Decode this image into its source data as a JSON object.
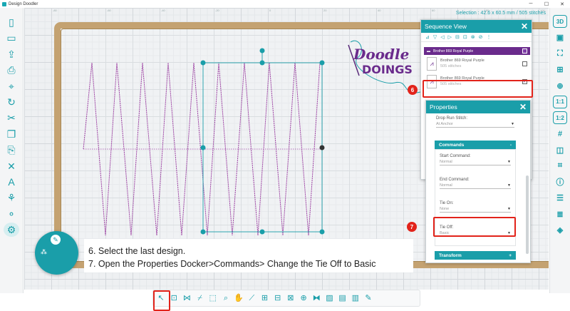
{
  "window": {
    "title": "Design Doodler",
    "minimize": "─",
    "maximize": "☐",
    "close": "✕"
  },
  "left_toolbar": [
    {
      "name": "new-file-icon",
      "glyph": "▯"
    },
    {
      "name": "open-folder-icon",
      "glyph": "▭"
    },
    {
      "name": "export-icon",
      "glyph": "⇪"
    },
    {
      "name": "print-icon",
      "glyph": "⎙"
    },
    {
      "name": "digitize-icon",
      "glyph": "⌖"
    },
    {
      "name": "redo-icon",
      "glyph": "↻"
    },
    {
      "name": "cut-icon",
      "glyph": "✂"
    },
    {
      "name": "copy-icon",
      "glyph": "❐"
    },
    {
      "name": "paste-icon",
      "glyph": "⎘"
    },
    {
      "name": "delete-icon",
      "glyph": "✕"
    },
    {
      "name": "text-icon",
      "glyph": "A"
    },
    {
      "name": "motif-icon",
      "glyph": "⚘"
    },
    {
      "name": "shapes-icon",
      "glyph": "⚬"
    },
    {
      "name": "stitch-tool-icon",
      "glyph": "⚙"
    }
  ],
  "right_toolbar": [
    {
      "name": "3d-view-icon",
      "glyph": "3D",
      "boxed": true
    },
    {
      "name": "square-view-icon",
      "glyph": "▣"
    },
    {
      "name": "zoom-fit-icon",
      "glyph": "⛶"
    },
    {
      "name": "zoom-selection-icon",
      "glyph": "⊞"
    },
    {
      "name": "zoom-in-icon",
      "glyph": "⊕"
    },
    {
      "name": "zoom-1-1-icon",
      "glyph": "1:1",
      "boxed": true
    },
    {
      "name": "zoom-2-1-icon",
      "glyph": "1:2",
      "boxed": true
    },
    {
      "name": "grid-icon",
      "glyph": "#"
    },
    {
      "name": "hoop-icon",
      "glyph": "◫"
    },
    {
      "name": "snap-icon",
      "glyph": "⌗"
    },
    {
      "name": "info-icon",
      "glyph": "ⓘ"
    },
    {
      "name": "sequence-view-icon",
      "glyph": "☰"
    },
    {
      "name": "properties-icon",
      "glyph": "≣"
    },
    {
      "name": "layers-icon",
      "glyph": "◈"
    }
  ],
  "canvas": {
    "selection_info": "Selection : 42.6 x 60.5 mm / 505 stitches",
    "ruler_ticks": [
      "-80",
      "-60",
      "-40",
      "-20",
      "0",
      "20",
      "40",
      "60",
      "80",
      "100"
    ]
  },
  "logo": {
    "line1": "Doodle",
    "line2": "DOINGS"
  },
  "sequence_view": {
    "title": "Sequence View",
    "close": "✕",
    "toolbar_icons": [
      "⊿",
      "▽",
      "◁",
      "▷",
      "⊟",
      "⊡",
      "⊗",
      "⊘",
      "⋮"
    ],
    "color_group": "Brother 869 Royal Purple",
    "color_swatch": "#7e3ca8",
    "items": [
      {
        "name": "Brother 869 Royal Purple",
        "sub": "505 stitches",
        "checked": false
      },
      {
        "name": "Brother 869 Royal Purple",
        "sub": "505 stitches",
        "checked": true
      }
    ]
  },
  "properties": {
    "title": "Properties",
    "close": "✕",
    "drop_run_label": "Drop Run Stitch:",
    "drop_run_value": "At Anchor",
    "commands_header": "Commands",
    "collapse": "-",
    "start_label": "Start Command:",
    "start_value": "Normal",
    "end_label": "End Command:",
    "end_value": "Normal",
    "tie_on_label": "Tie On:",
    "tie_on_value": "None",
    "tie_off_label": "Tie Off:",
    "tie_off_value": "Basic",
    "transform_header": "Transform",
    "expand": "+"
  },
  "steps": {
    "six": "6",
    "seven": "7"
  },
  "instructions": {
    "line1": "6. Select the last design.",
    "line2": "7. Open the Properties Docker>Commands> Change the Tie Off to Basic"
  },
  "bottom_toolbar": [
    {
      "name": "select-pointer-icon",
      "glyph": "↖"
    },
    {
      "name": "node-edit-icon",
      "glyph": "⊡"
    },
    {
      "name": "reshape-icon",
      "glyph": "⋈"
    },
    {
      "name": "knife-icon",
      "glyph": "⌿"
    },
    {
      "name": "crop-icon",
      "glyph": "⬚"
    },
    {
      "name": "zoom-icon",
      "glyph": "⌕"
    },
    {
      "name": "pan-hand-icon",
      "glyph": "✋"
    },
    {
      "name": "measure-icon",
      "glyph": "⟋"
    },
    {
      "name": "align-icon",
      "glyph": "⊞"
    },
    {
      "name": "distribute-icon",
      "glyph": "⊟"
    },
    {
      "name": "group-icon",
      "glyph": "⊠"
    },
    {
      "name": "center-icon",
      "glyph": "⊕"
    },
    {
      "name": "mirror-icon",
      "glyph": "⧓"
    },
    {
      "name": "image-icon",
      "glyph": "▨"
    },
    {
      "name": "layer-icon",
      "glyph": "▤"
    },
    {
      "name": "fill-icon",
      "glyph": "▥"
    },
    {
      "name": "edit-icon",
      "glyph": "✎"
    }
  ],
  "colors": {
    "accent": "#1a9ea9",
    "highlight": "#e2231a",
    "thread": "#a04aa6",
    "hoop": "#c4a271"
  }
}
